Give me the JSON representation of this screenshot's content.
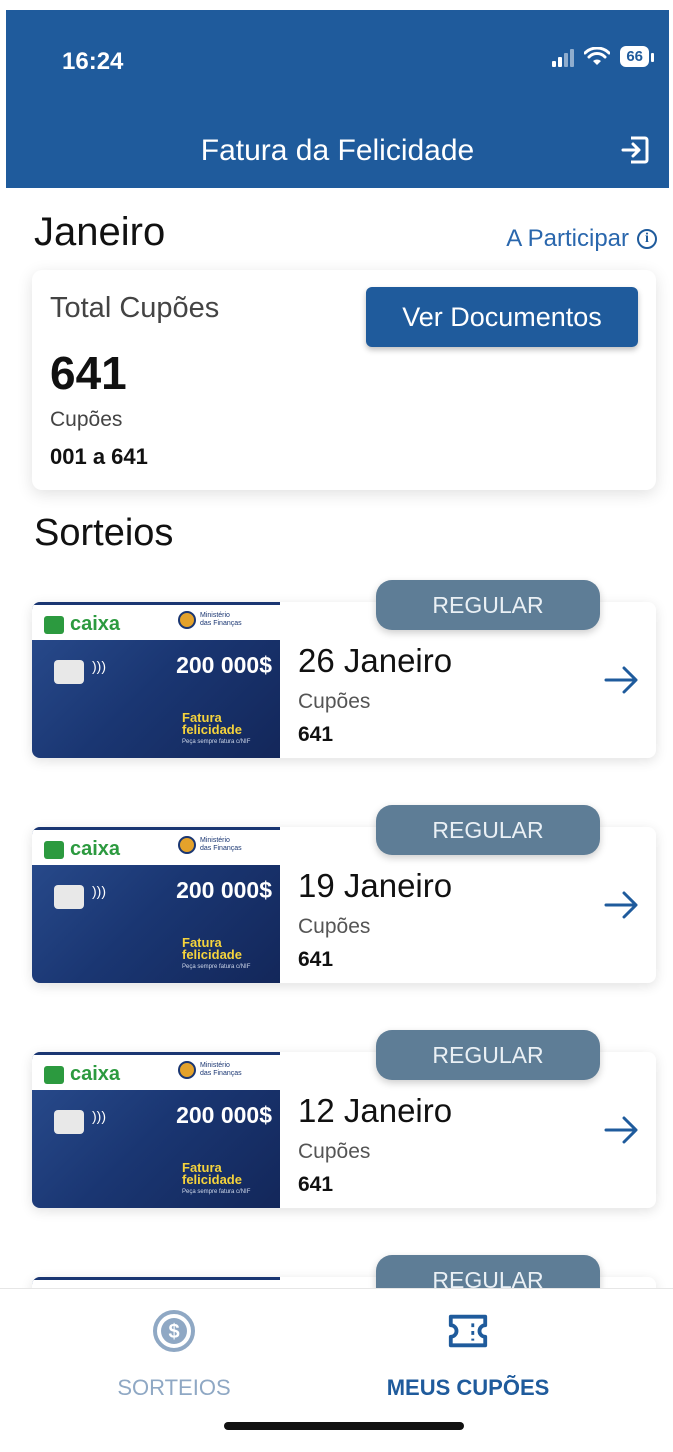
{
  "status": {
    "time": "16:24",
    "battery": "66"
  },
  "header": {
    "title": "Fatura da Felicidade",
    "exit_icon": "exit-icon"
  },
  "month": {
    "title": "Janeiro",
    "status": "A Participar"
  },
  "summary": {
    "total_label": "Total Cupões",
    "total_value": "641",
    "cupoes_label": "Cupões",
    "cupoes_range": "001 a 641",
    "docs_button": "Ver Documentos"
  },
  "section_title": "Sorteios",
  "card_image": {
    "bank": "caixa",
    "ministry_line1": "Ministério",
    "ministry_line2": "das Finanças",
    "prize": "200 000$",
    "fatura_1": "Fatura",
    "fatura_2": "felicidade",
    "tagline": "Peça sempre fatura c/NIF"
  },
  "draws": [
    {
      "badge": "REGULAR",
      "date": "26 Janeiro",
      "cupoes_label": "Cupões",
      "cupoes": "641"
    },
    {
      "badge": "REGULAR",
      "date": "19 Janeiro",
      "cupoes_label": "Cupões",
      "cupoes": "641"
    },
    {
      "badge": "REGULAR",
      "date": "12 Janeiro",
      "cupoes_label": "Cupões",
      "cupoes": "641"
    },
    {
      "badge": "REGULAR",
      "date": "",
      "cupoes_label": "",
      "cupoes": ""
    }
  ],
  "nav": [
    {
      "label": "SORTEIOS",
      "icon": "dollar-icon",
      "active": false
    },
    {
      "label": "MEUS CUPÕES",
      "icon": "ticket-icon",
      "active": true
    }
  ],
  "colors": {
    "primary": "#1f5b9c",
    "badge": "#5e7d96",
    "inactive": "#8fa8c4"
  }
}
